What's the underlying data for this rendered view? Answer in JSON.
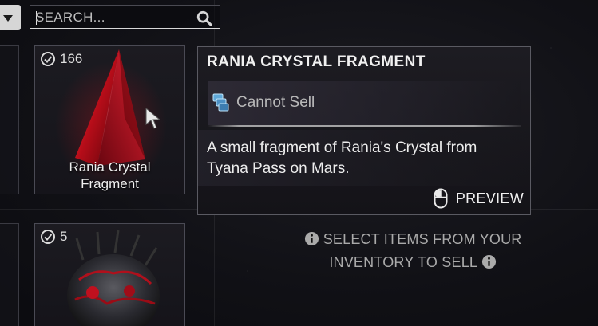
{
  "search": {
    "placeholder": "SEARCH..."
  },
  "items": [
    {
      "count": "166",
      "name_line1": "Rania Crystal",
      "name_line2": "Fragment"
    },
    {
      "count": "5"
    }
  ],
  "tooltip": {
    "title": "RANIA CRYSTAL FRAGMENT",
    "sell_status": "Cannot Sell",
    "description": "A small fragment of Rania's Crystal from Tyana Pass on Mars.",
    "preview_label": "PREVIEW"
  },
  "hint": {
    "line1": "SELECT ITEMS FROM YOUR",
    "line2": "INVENTORY TO SELL"
  },
  "colors": {
    "crystal_red": "#c8101c",
    "accent_text": "#f1f1f1",
    "muted_text": "#aaaaaa"
  },
  "icons": [
    "chevron-down-icon",
    "search-icon",
    "checkmark-circle-icon",
    "credits-icon",
    "mouse-icon",
    "info-icon",
    "cursor-icon"
  ]
}
